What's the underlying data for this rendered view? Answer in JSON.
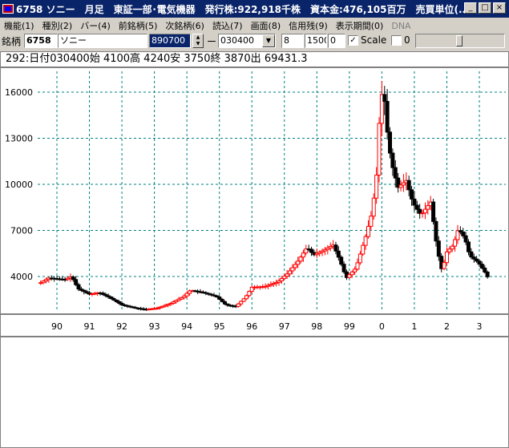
{
  "window": {
    "title": "6758 ソニー　月足　東証一部･電気機器　発行株:922,918千株　資本金:476,105百万　売買単位(...",
    "min_label": "_",
    "max_label": "□",
    "close_label": "×"
  },
  "menu": {
    "items": [
      {
        "label": "機能(1)"
      },
      {
        "label": "種別(2)"
      },
      {
        "label": "バー(4)"
      },
      {
        "label": "前銘柄(5)"
      },
      {
        "label": "次銘柄(6)"
      },
      {
        "label": "読込(7)"
      },
      {
        "label": "画面(8)"
      },
      {
        "label": "信用残(9)"
      },
      {
        "label": "表示期間(0)"
      },
      {
        "label": "DNA"
      }
    ]
  },
  "toolbar": {
    "stock_label": "銘柄",
    "code": "6758",
    "name": "ソニー",
    "value_field": "890700",
    "dash": "ー",
    "date_field": "030400",
    "field_a": "8",
    "field_b": "1500",
    "field_c": "0",
    "scale_label": "Scale",
    "scale_checked": "✓",
    "field_d": "0"
  },
  "info": {
    "text": "292:日付030400始 4100高 4240安 3750終 3870出 69431.3"
  },
  "chart_data": {
    "type": "candlestick",
    "title": "",
    "xlabel": "",
    "ylabel": "",
    "ylim": [
      1500,
      17500
    ],
    "y_ticks": [
      4000,
      7000,
      10000,
      13000,
      16000
    ],
    "y_tick_labels": [
      "4000",
      "7000",
      "10000",
      "13000",
      "16000"
    ],
    "x_tick_labels": [
      "90",
      "91",
      "92",
      "93",
      "94",
      "95",
      "96",
      "97",
      "98",
      "99",
      "0",
      "1",
      "2",
      "3"
    ],
    "grid": "dashed",
    "up_color": "#ff0000",
    "down_color": "#000000",
    "grid_color": "#008080",
    "series": [
      {
        "t": 1989.5,
        "v": 3600
      },
      {
        "t": 1989.75,
        "v": 3900
      },
      {
        "t": 1990.0,
        "v": 3850
      },
      {
        "t": 1990.25,
        "v": 3800
      },
      {
        "t": 1990.45,
        "v": 4000
      },
      {
        "t": 1990.65,
        "v": 3200
      },
      {
        "t": 1991.0,
        "v": 2850
      },
      {
        "t": 1991.3,
        "v": 2950
      },
      {
        "t": 1991.6,
        "v": 2650
      },
      {
        "t": 1992.0,
        "v": 2150
      },
      {
        "t": 1992.4,
        "v": 1950
      },
      {
        "t": 1992.75,
        "v": 1850
      },
      {
        "t": 1993.1,
        "v": 1950
      },
      {
        "t": 1993.5,
        "v": 2250
      },
      {
        "t": 1993.9,
        "v": 2700
      },
      {
        "t": 1994.1,
        "v": 3100
      },
      {
        "t": 1994.5,
        "v": 2950
      },
      {
        "t": 1994.9,
        "v": 2700
      },
      {
        "t": 1995.2,
        "v": 2150
      },
      {
        "t": 1995.5,
        "v": 2050
      },
      {
        "t": 1995.8,
        "v": 2650
      },
      {
        "t": 1996.0,
        "v": 3300
      },
      {
        "t": 1996.4,
        "v": 3350
      },
      {
        "t": 1996.8,
        "v": 3650
      },
      {
        "t": 1997.1,
        "v": 4200
      },
      {
        "t": 1997.4,
        "v": 4950
      },
      {
        "t": 1997.7,
        "v": 5900
      },
      {
        "t": 1997.9,
        "v": 5400
      },
      {
        "t": 1998.2,
        "v": 5700
      },
      {
        "t": 1998.5,
        "v": 6050
      },
      {
        "t": 1998.7,
        "v": 5100
      },
      {
        "t": 1998.9,
        "v": 3900
      },
      {
        "t": 1999.2,
        "v": 4550
      },
      {
        "t": 1999.5,
        "v": 6600
      },
      {
        "t": 1999.7,
        "v": 8200
      },
      {
        "t": 1999.85,
        "v": 10900
      },
      {
        "t": 1999.95,
        "v": 15500
      },
      {
        "t": 2000.05,
        "v": 16200
      },
      {
        "t": 2000.2,
        "v": 12600
      },
      {
        "t": 2000.35,
        "v": 10900
      },
      {
        "t": 2000.5,
        "v": 9800
      },
      {
        "t": 2000.75,
        "v": 10250
      },
      {
        "t": 2000.95,
        "v": 8800
      },
      {
        "t": 2001.2,
        "v": 8000
      },
      {
        "t": 2001.5,
        "v": 8850
      },
      {
        "t": 2001.7,
        "v": 5800
      },
      {
        "t": 2001.85,
        "v": 4350
      },
      {
        "t": 2002.0,
        "v": 5600
      },
      {
        "t": 2002.2,
        "v": 6050
      },
      {
        "t": 2002.35,
        "v": 7100
      },
      {
        "t": 2002.55,
        "v": 6500
      },
      {
        "t": 2002.7,
        "v": 5350
      },
      {
        "t": 2002.95,
        "v": 4950
      },
      {
        "t": 2003.15,
        "v": 4350
      },
      {
        "t": 2003.28,
        "v": 3870
      }
    ]
  }
}
